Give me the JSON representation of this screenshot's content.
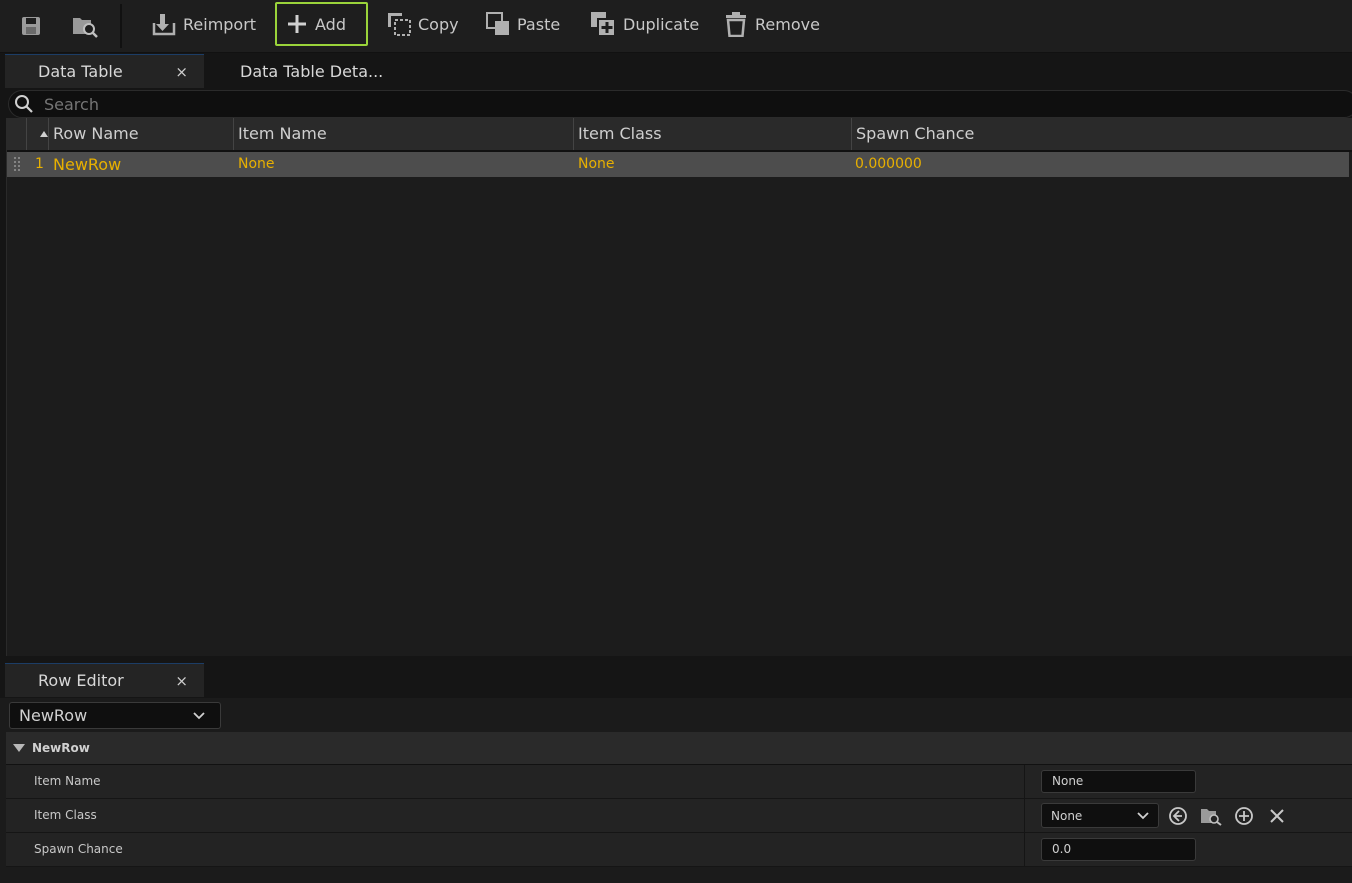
{
  "toolbar": {
    "buttons": [
      {
        "label": "Reimport",
        "icon": "reimport-icon"
      },
      {
        "label": "Add",
        "icon": "plus-icon"
      },
      {
        "label": "Copy",
        "icon": "copy-icon"
      },
      {
        "label": "Paste",
        "icon": "paste-icon"
      },
      {
        "label": "Duplicate",
        "icon": "duplicate-icon"
      },
      {
        "label": "Remove",
        "icon": "trash-icon"
      }
    ],
    "icons": [
      "save-icon",
      "browse-icon"
    ],
    "active_color": "#9ad33a"
  },
  "tabs": [
    {
      "label": "Data Table",
      "close": "×"
    },
    {
      "label": "Data Table Deta..."
    }
  ],
  "search": {
    "placeholder": "Search"
  },
  "table": {
    "columns": [
      "Row Name",
      "Item Name",
      "Item Class",
      "Spawn Chance"
    ],
    "rows": [
      {
        "index": "1",
        "row_name": "NewRow",
        "item_name": "None",
        "item_class": "None",
        "spawn_chance": "0.000000"
      }
    ],
    "highlight_color": "#e8b000"
  },
  "row_editor": {
    "tab_label": "Row Editor",
    "close": "×",
    "selected_row": "NewRow",
    "category": "NewRow",
    "properties": [
      {
        "name": "Item Name",
        "value": "None"
      },
      {
        "name": "Item Class",
        "value": "None"
      },
      {
        "name": "Spawn Chance",
        "value": "0.0"
      }
    ]
  }
}
